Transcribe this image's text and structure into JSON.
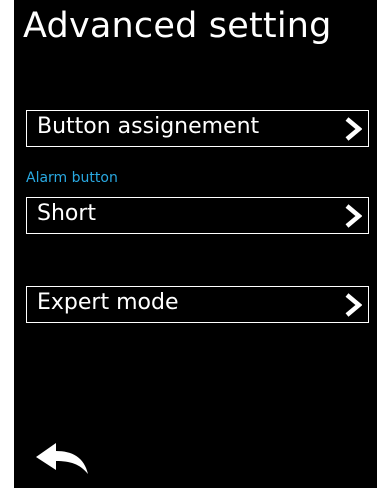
{
  "screen": {
    "title": "Advanced setting",
    "items": [
      {
        "label": "Button assignement"
      },
      {
        "label": "Short",
        "section_label": "Alarm button"
      },
      {
        "label": "Expert mode"
      }
    ]
  },
  "icons": {
    "chevron": "chevron-right-icon",
    "back": "back-arrow-icon"
  },
  "colors": {
    "background": "#000000",
    "text": "#ffffff",
    "accent": "#29a8e0"
  }
}
